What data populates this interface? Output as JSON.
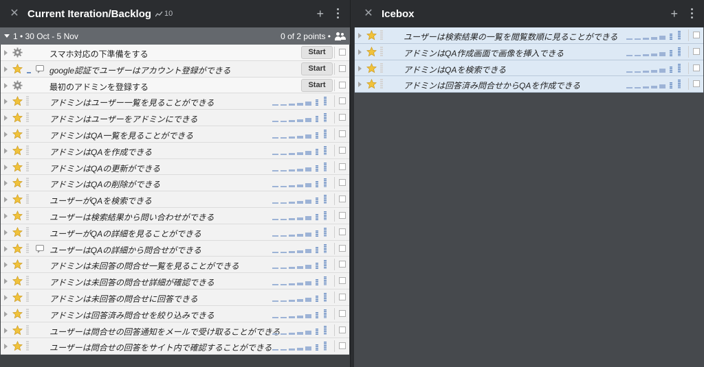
{
  "backlog": {
    "title": "Current Iteration/Backlog",
    "velocity": "10",
    "iteration": {
      "label": "1 • 30 Oct - 5 Nov",
      "points": "0 of 2 points •"
    },
    "stories": [
      {
        "type": "chore",
        "title": "スマホ対応の下準備をする",
        "start_label": "Start",
        "comment": false
      },
      {
        "type": "feature",
        "title": "google認証でユーザーはアカウント登録ができる",
        "start_label": "Start",
        "comment": true,
        "estimated": true
      },
      {
        "type": "chore",
        "title": "最初のアドミンを登録する",
        "start_label": "Start",
        "comment": false
      },
      {
        "type": "feature",
        "title": "アドミンはユーザー一覧を見ることができる"
      },
      {
        "type": "feature",
        "title": "アドミンはユーザーをアドミンにできる"
      },
      {
        "type": "feature",
        "title": "アドミンはQA一覧を見ることができる"
      },
      {
        "type": "feature",
        "title": "アドミンはQAを作成できる"
      },
      {
        "type": "feature",
        "title": "アドミンはQAの更新ができる"
      },
      {
        "type": "feature",
        "title": "アドミンはQAの削除ができる"
      },
      {
        "type": "feature",
        "title": "ユーザーがQAを検索できる"
      },
      {
        "type": "feature",
        "title": "ユーザーは検索結果から問い合わせができる"
      },
      {
        "type": "feature",
        "title": "ユーザーがQAの詳細を見ることができる"
      },
      {
        "type": "feature",
        "title": "ユーザーはQAの詳細から問合せができる",
        "comment": true
      },
      {
        "type": "feature",
        "title": "アドミンは未回答の問合せ一覧を見ることができる"
      },
      {
        "type": "feature",
        "title": "アドミンは未回答の問合せ詳細が確認できる"
      },
      {
        "type": "feature",
        "title": "アドミンは未回答の問合せに回答できる"
      },
      {
        "type": "feature",
        "title": "アドミンは回答済み問合せを絞り込みできる"
      },
      {
        "type": "feature",
        "title": "ユーザーは問合せの回答通知をメールで受け取ることができる"
      },
      {
        "type": "feature",
        "title": "ユーザーは問合せの回答をサイト内で確認することができる"
      }
    ]
  },
  "icebox": {
    "title": "Icebox",
    "stories": [
      {
        "type": "feature",
        "title": "ユーザーは検索結果の一覧を閲覧数順に見ることができる"
      },
      {
        "type": "feature",
        "title": "アドミンはQA作成画面で画像を挿入できる"
      },
      {
        "type": "feature",
        "title": "アドミンはQAを検索できる"
      },
      {
        "type": "feature",
        "title": "アドミンは回答済み問合せからQAを作成できる"
      }
    ]
  },
  "colors": {
    "header_bg": "#2b2d30",
    "iteration_bar": "#64686d",
    "star": "#f0c23b",
    "icebox_story": "#dde9f5"
  },
  "icons": {
    "close": "close-icon",
    "add": "plus-icon",
    "more": "more-vertical-icon",
    "velocity": "velocity-icon",
    "members": "people-icon",
    "chore": "gear-icon",
    "feature": "star-icon",
    "comment": "comment-icon"
  }
}
